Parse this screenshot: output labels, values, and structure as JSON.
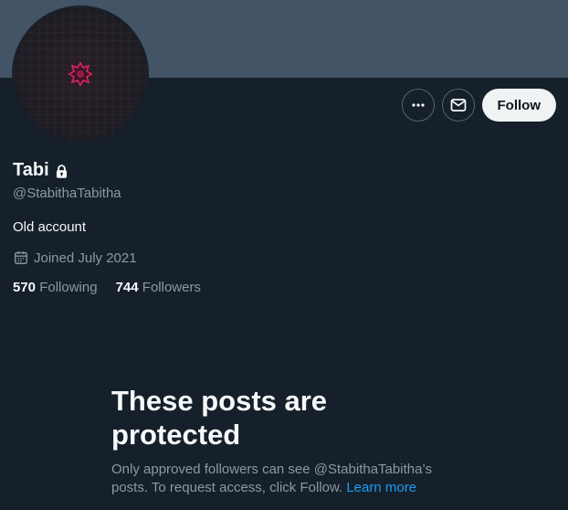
{
  "profile": {
    "display_name": "Tabi",
    "handle": "@StabithaTabitha",
    "bio": "Old account",
    "joined": "Joined July 2021",
    "following_count": "570",
    "following_label": "Following",
    "followers_count": "744",
    "followers_label": "Followers"
  },
  "actions": {
    "more_icon": "more-horizontal-icon",
    "message_icon": "envelope-icon",
    "follow_label": "Follow"
  },
  "protected_notice": {
    "title_line1": "These posts are",
    "title_line2": "protected",
    "text": "Only approved followers can see @StabithaTabitha’s posts. To request access, click Follow.",
    "link": "Learn more"
  },
  "colors": {
    "background": "#15202b",
    "banner": "#425466",
    "link": "#1d9bf0",
    "secondary_text": "#8b98a5",
    "avatar_star": "#e0245e"
  }
}
